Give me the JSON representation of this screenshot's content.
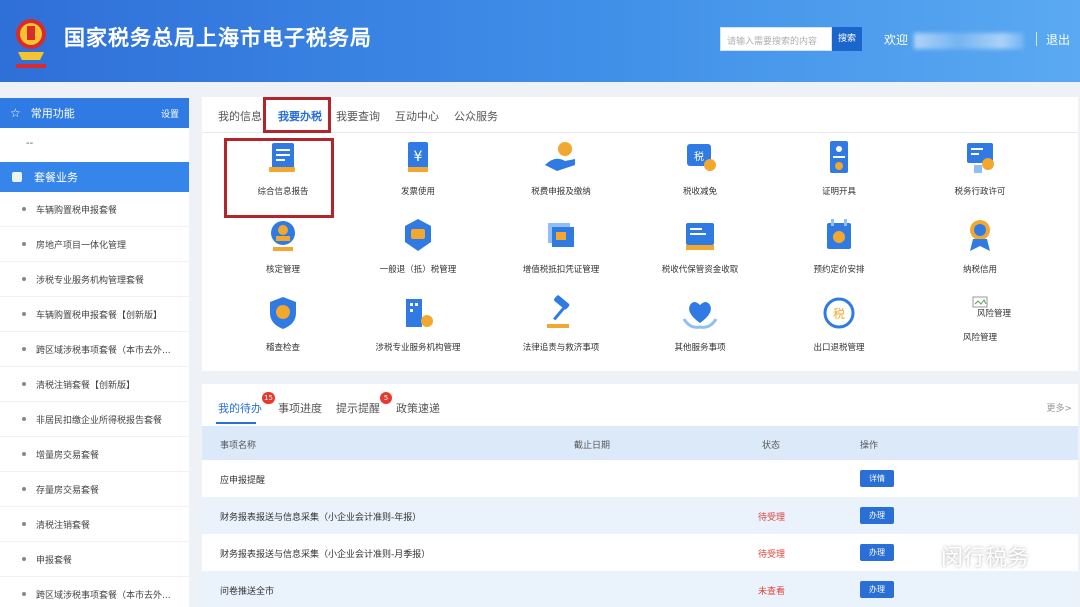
{
  "header": {
    "title": "国家税务总局上海市电子税务局",
    "search_placeholder": "请输入需要搜索的内容",
    "search_button": "搜索",
    "welcome": "欢迎",
    "logout": "退出",
    "emblem_icon": "tax-emblem-icon"
  },
  "sidebar": {
    "common_label": "常用功能",
    "settings_label": "设置",
    "dash": "--",
    "package_label": "套餐业务",
    "items": [
      {
        "label": "车辆购置税申报套餐"
      },
      {
        "label": "房地产项目一体化管理"
      },
      {
        "label": "涉税专业服务机构管理套餐"
      },
      {
        "label": "车辆购置税申报套餐【创新版】"
      },
      {
        "label": "跨区域涉税事项套餐（本市去外..."
      },
      {
        "label": "清税注销套餐【创新版】"
      },
      {
        "label": "非居民扣缴企业所得税报告套餐"
      },
      {
        "label": "增量房交易套餐"
      },
      {
        "label": "存量房交易套餐"
      },
      {
        "label": "清税注销套餐"
      },
      {
        "label": "申报套餐"
      },
      {
        "label": "跨区域涉税事项套餐（本市去外..."
      }
    ]
  },
  "main_tabs": [
    "我的信息",
    "我要办税",
    "我要查询",
    "互动中心",
    "公众服务"
  ],
  "functions": [
    {
      "label": "综合信息报告",
      "icon": "document-report-icon"
    },
    {
      "label": "发票使用",
      "icon": "invoice-icon"
    },
    {
      "label": "税费申报及缴纳",
      "icon": "hand-coin-icon"
    },
    {
      "label": "税收减免",
      "icon": "tax-reduction-icon"
    },
    {
      "label": "证明开具",
      "icon": "certificate-icon"
    },
    {
      "label": "税务行政许可",
      "icon": "admin-permit-icon"
    },
    {
      "label": "核定管理",
      "icon": "seal-stamp-icon"
    },
    {
      "label": "一般退（抵）税管理",
      "icon": "refund-icon"
    },
    {
      "label": "增值税抵扣凭证管理",
      "icon": "vat-voucher-icon"
    },
    {
      "label": "税收代保管资金收取",
      "icon": "fund-custody-icon"
    },
    {
      "label": "预约定价安排",
      "icon": "calendar-pricing-icon"
    },
    {
      "label": "纳税信用",
      "icon": "credit-medal-icon"
    },
    {
      "label": "稽查检查",
      "icon": "shield-inspection-icon"
    },
    {
      "label": "涉税专业服务机构管理",
      "icon": "agency-building-icon"
    },
    {
      "label": "法律追责与救济事项",
      "icon": "gavel-icon"
    },
    {
      "label": "其他服务事项",
      "icon": "heart-hands-icon"
    },
    {
      "label": "出口退税管理",
      "icon": "export-refund-icon"
    },
    {
      "label": "风险管理",
      "icon": "broken-image-icon",
      "alt": "风险管理"
    }
  ],
  "todo": {
    "tabs": [
      {
        "label": "我的待办",
        "badge": "15"
      },
      {
        "label": "事项进度",
        "badge": ""
      },
      {
        "label": "提示提醒",
        "badge": "5"
      },
      {
        "label": "政策速递",
        "badge": ""
      }
    ],
    "more": "更多>",
    "columns": {
      "name": "事项名称",
      "deadline": "截止日期",
      "status": "状态",
      "action": "操作"
    },
    "rows": [
      {
        "name": "应申报提醒",
        "status": "",
        "action": "详情"
      },
      {
        "name": "财务报表报送与信息采集（小企业会计准则-年报）",
        "status": "待受理",
        "action": "办理"
      },
      {
        "name": "财务报表报送与信息采集（小企业会计准则-月季报）",
        "status": "待受理",
        "action": "办理"
      },
      {
        "name": "问卷推送全市",
        "status": "未查看",
        "action": "办理"
      }
    ]
  },
  "watermark": {
    "text": "闵行税务",
    "icon": "wechat-icon"
  },
  "colors": {
    "header_blue": "#2f6fd8",
    "accent_blue": "#2a6fd6",
    "highlight_red": "#b3252b",
    "status_red": "#e0443a",
    "badge_red": "#e8392f"
  }
}
